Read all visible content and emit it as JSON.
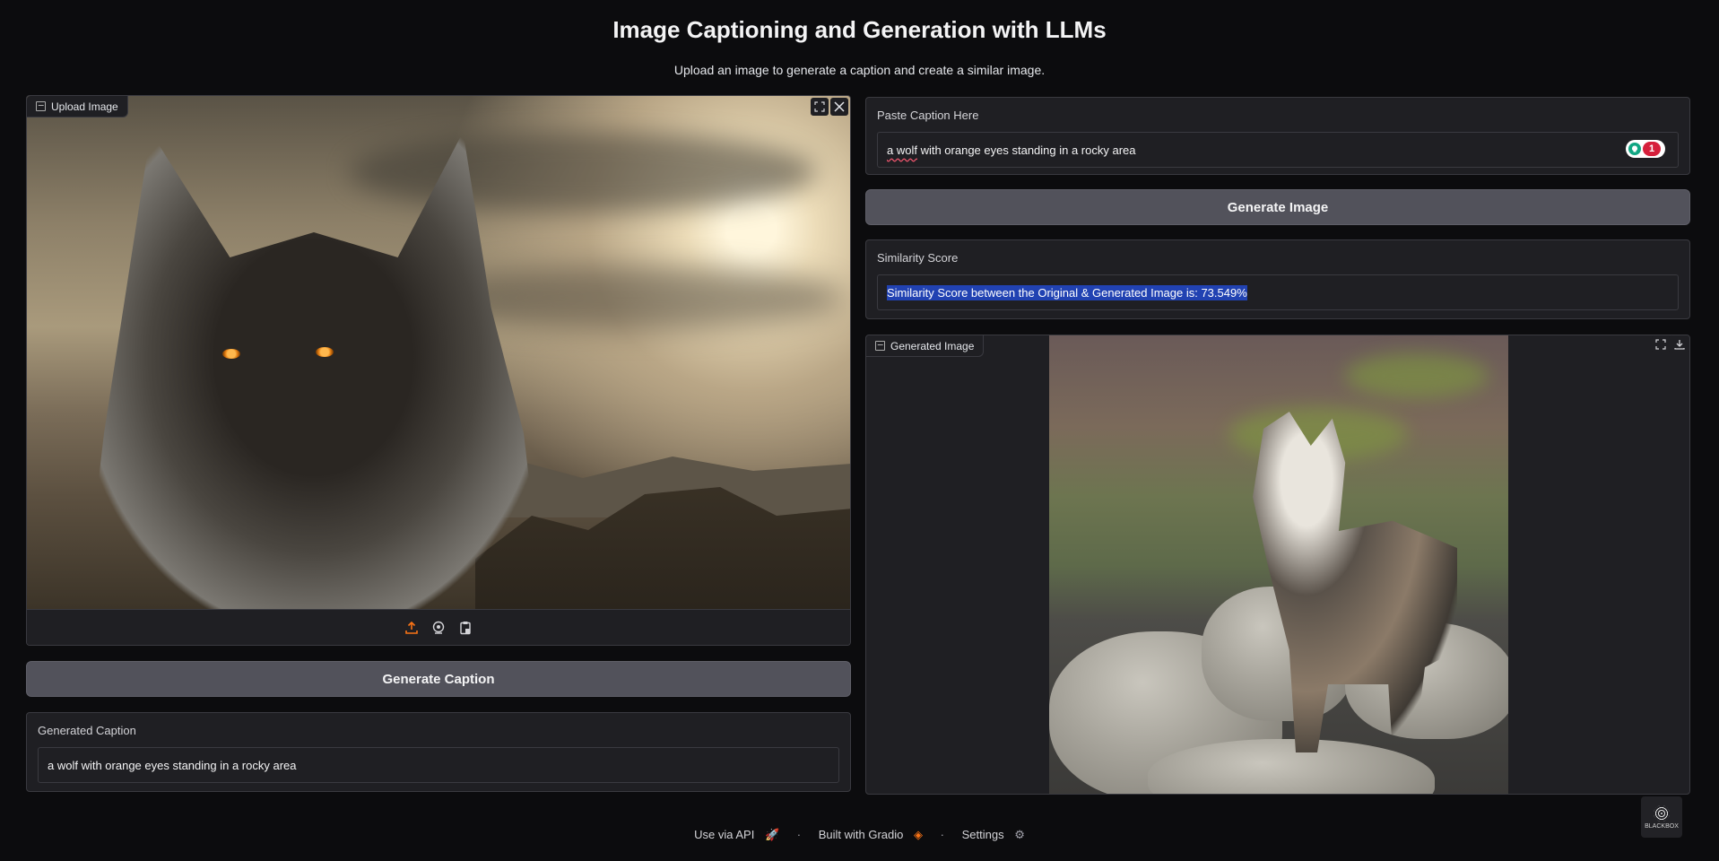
{
  "header": {
    "title": "Image Captioning and Generation with LLMs",
    "subtitle": "Upload an image to generate a caption and create a similar image."
  },
  "upload": {
    "label": "Upload Image"
  },
  "buttons": {
    "generate_caption": "Generate Caption",
    "generate_image": "Generate Image"
  },
  "generated_caption": {
    "label": "Generated Caption",
    "value": "a wolf with orange eyes standing in a rocky area"
  },
  "caption_input": {
    "label": "Paste Caption Here",
    "value_flagged": "a wolf",
    "value_rest": " with orange eyes standing in a rocky area",
    "grammar_count": "1"
  },
  "similarity": {
    "label": "Similarity Score",
    "value": "Similarity Score between the Original & Generated Image is: 73.549%"
  },
  "generated_image": {
    "label": "Generated Image"
  },
  "footer": {
    "api": "Use via API",
    "built": "Built with Gradio",
    "settings": "Settings"
  },
  "extension": {
    "name": "BLACKBOX"
  },
  "colors": {
    "background": "#0c0c0e",
    "panel": "#1f1f23",
    "button": "#52525b",
    "accent_orange": "#f97316",
    "selection": "#2142b2"
  }
}
